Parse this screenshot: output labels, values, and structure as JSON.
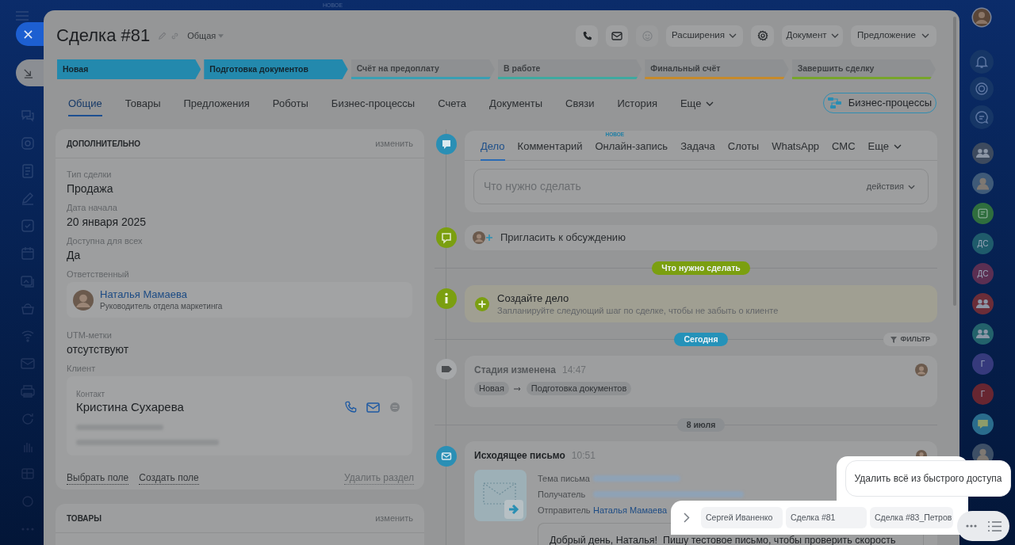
{
  "background": {
    "badge": "НОВОЕ"
  },
  "deal": {
    "title": "Сделка #81",
    "category": "Общая",
    "dropdowns": [
      "Расширения",
      "Документ",
      "Предложение"
    ]
  },
  "stages": [
    {
      "label": "Новая",
      "color": "#2389ad",
      "passed": true
    },
    {
      "label": "Подготовка документов",
      "color": "#2389ad",
      "passed": true
    },
    {
      "label": "Счёт на предоплату",
      "color": "#3a9fb3",
      "passed": false
    },
    {
      "label": "В работе",
      "color": "#3fa9a0",
      "passed": false
    },
    {
      "label": "Финальный счёт",
      "color": "#c68a2b",
      "passed": false
    },
    {
      "label": "Завершить сделку",
      "color": "#77a52b",
      "passed": false
    }
  ],
  "tabs": [
    {
      "label": "Общие",
      "kind": "tab",
      "selected": true
    },
    {
      "label": "Товары",
      "kind": "tab",
      "selected": false
    },
    {
      "label": "Предложения",
      "kind": "tab",
      "selected": false
    },
    {
      "label": "Роботы",
      "kind": "tab",
      "selected": false
    },
    {
      "label": "Бизнес-процессы",
      "kind": "tab",
      "selected": false
    },
    {
      "label": "Счета",
      "kind": "tab",
      "selected": false
    },
    {
      "label": "Документы",
      "kind": "tab",
      "selected": false
    },
    {
      "label": "Связи",
      "kind": "tab",
      "selected": false
    },
    {
      "label": "История",
      "kind": "tab",
      "selected": false
    },
    {
      "label": "Еще",
      "kind": "more",
      "selected": false
    }
  ],
  "process_button": "Бизнес-процессы",
  "details": {
    "title": "ДОПОЛНИТЕЛЬНО",
    "action": "изменить",
    "fields": [
      {
        "kind": "text",
        "label": "Тип сделки",
        "value": "Продажа"
      },
      {
        "kind": "text",
        "label": "Дата начала",
        "value": "20 января 2025"
      },
      {
        "kind": "text",
        "label": "Доступна для всех",
        "value": "Да"
      },
      {
        "kind": "person",
        "label": "Ответственный",
        "name": "Наталья Мамаева",
        "position": "Руководитель отдела маркетинга"
      },
      {
        "kind": "text",
        "label": "UTM-метки",
        "value": "отсутствуют"
      },
      {
        "kind": "client",
        "label": "Клиент",
        "type": "Контакт",
        "name": "Кристина Сухарева"
      }
    ],
    "links": [
      {
        "label": "Выбрать поле",
        "disabled": false
      },
      {
        "label": "Создать поле",
        "disabled": false
      },
      {
        "label": "Удалить раздел",
        "disabled": true
      }
    ]
  },
  "products": {
    "title": "ТОВАРЫ",
    "action": "изменить"
  },
  "composer": {
    "tabs": [
      {
        "label": "Дело",
        "kind": "tab",
        "selected": true
      },
      {
        "label": "Комментарий",
        "kind": "tab",
        "selected": false
      },
      {
        "label": "Онлайн-запись",
        "kind": "tab",
        "selected": false,
        "badge": "НОВОЕ"
      },
      {
        "label": "Задача",
        "kind": "tab",
        "selected": false
      },
      {
        "label": "Слоты",
        "kind": "tab",
        "selected": false
      },
      {
        "label": "WhatsApp",
        "kind": "tab",
        "selected": false
      },
      {
        "label": "СМС",
        "kind": "tab",
        "selected": false
      },
      {
        "label": "Еще",
        "kind": "more",
        "selected": false
      }
    ],
    "placeholder": "Что нужно сделать",
    "actions": "действия"
  },
  "invite": "Пригласить к обсуждению",
  "timeline": [
    {
      "kind": "divider",
      "label": "Что нужно сделать",
      "color": "#7b9f10"
    },
    {
      "kind": "hint",
      "title": "Создайте дело",
      "text": "Запланируйте следующий шаг по сделке, чтобы не забыть о клиенте"
    },
    {
      "kind": "divider",
      "label": "Сегодня",
      "color": "#2592b9",
      "filter": "ФИЛЬТР"
    },
    {
      "kind": "stage",
      "title": "Стадия изменена",
      "time": "14:47",
      "from": "Новая",
      "to": "Подготовка документов"
    },
    {
      "kind": "divider",
      "label": "8 июля",
      "color": "#8b8e91"
    },
    {
      "kind": "email",
      "title": "Исходящее письмо",
      "time": "10:51",
      "fields": [
        {
          "label": "Тема письма"
        },
        {
          "label": "Получатель"
        },
        {
          "label": "Отправитель",
          "value": "Наталья Мамаева"
        }
      ],
      "body": "Добрый день, Наталья!  Пишу тестовое письмо, чтобы проверить скорость"
    }
  ],
  "quick_access": {
    "items": [
      "Сергей Иваненко",
      "Сделка #81",
      "Сделка #83_Петров"
    ],
    "tooltip": "Удалить всё из быстрого доступа"
  },
  "chats": [
    {
      "kind": "group",
      "color": "#3d4a5e"
    },
    {
      "kind": "photo",
      "color": "#3f5a78"
    },
    {
      "kind": "app",
      "color": "#2f6e3e"
    },
    {
      "kind": "initials",
      "initials": "ДС",
      "color": "#1f5b6b"
    },
    {
      "kind": "initials",
      "initials": "ДС",
      "color": "#5b2f52"
    },
    {
      "kind": "group",
      "color": "#6b2d38"
    },
    {
      "kind": "group",
      "color": "#23626b"
    },
    {
      "kind": "initials",
      "initials": "Г",
      "color": "#363a7c"
    },
    {
      "kind": "initials",
      "initials": "Г",
      "color": "#672631"
    },
    {
      "kind": "chat",
      "color": "#2a6c8c"
    },
    {
      "kind": "photo",
      "color": "#3d4f66"
    }
  ]
}
